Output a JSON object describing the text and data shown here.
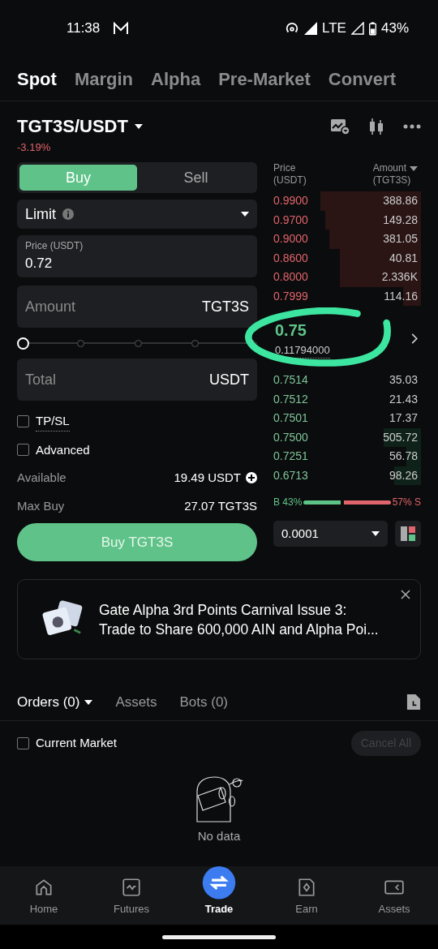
{
  "status_bar": {
    "time": "11:38",
    "network": "LTE",
    "battery": "43%"
  },
  "tabs": [
    {
      "label": "Spot",
      "selected": true
    },
    {
      "label": "Margin",
      "selected": false
    },
    {
      "label": "Alpha",
      "selected": false
    },
    {
      "label": "Pre-Market",
      "selected": false
    },
    {
      "label": "Convert",
      "selected": false
    }
  ],
  "pair": {
    "name": "TGT3S/USDT",
    "change": "-3.19%"
  },
  "order_form": {
    "sides": [
      {
        "label": "Buy",
        "selected": true
      },
      {
        "label": "Sell",
        "selected": false
      }
    ],
    "order_type": "Limit",
    "price": {
      "label": "Price (USDT)",
      "value": "0.72"
    },
    "amount": {
      "placeholder": "Amount",
      "unit": "TGT3S"
    },
    "slider": {
      "level": 0
    },
    "total": {
      "placeholder": "Total",
      "unit": "USDT"
    },
    "options": [
      {
        "label": "TP/SL",
        "checked": false
      },
      {
        "label": "Advanced",
        "checked": false
      }
    ],
    "available": {
      "label": "Available",
      "value": "19.49 USDT"
    },
    "max_buy": {
      "label": "Max Buy",
      "value": "27.07 TGT3S"
    },
    "submit": "Buy TGT3S"
  },
  "order_book": {
    "columns": [
      "Price\n(USDT)",
      "Amount",
      "(TGT3S)"
    ],
    "asks": [
      {
        "price": "0.9900",
        "amount": "388.86"
      },
      {
        "price": "0.9700",
        "amount": "149.28"
      },
      {
        "price": "0.9000",
        "amount": "381.05"
      },
      {
        "price": "0.8600",
        "amount": "40.81"
      },
      {
        "price": "0.8000",
        "amount": "2.336K"
      },
      {
        "price": "0.7999",
        "amount": "114.16"
      }
    ],
    "last_price": "0.75",
    "mark_price": "0.11794000",
    "bids": [
      {
        "price": "0.7514",
        "amount": "35.03"
      },
      {
        "price": "0.7512",
        "amount": "21.43"
      },
      {
        "price": "0.7501",
        "amount": "17.37"
      },
      {
        "price": "0.7500",
        "amount": "505.72"
      },
      {
        "price": "0.7251",
        "amount": "56.78"
      },
      {
        "price": "0.6713",
        "amount": "98.26"
      }
    ],
    "ratio": {
      "buy": "B 43%",
      "sell": "57% S",
      "level": 0.43
    },
    "precision": "0.0001"
  },
  "banner": {
    "text": "Gate Alpha 3rd Points Carnival Issue 3:\nTrade to Share 600,000 AIN and Alpha Poi..."
  },
  "orders": {
    "tabs": [
      {
        "label": "Orders (0)",
        "selected": true
      },
      {
        "label": "Assets",
        "selected": false
      },
      {
        "label": "Bots (0)",
        "selected": false
      }
    ],
    "filter": {
      "label": "Current Market",
      "checked": false
    },
    "cancel_all": "Cancel All",
    "empty": "No data"
  },
  "bottom_nav": [
    {
      "label": "Home",
      "kind": "home",
      "selected": false
    },
    {
      "label": "Futures",
      "kind": "futures",
      "selected": false
    },
    {
      "label": "Trade",
      "kind": "trade",
      "selected": true
    },
    {
      "label": "Earn",
      "kind": "earn",
      "selected": false
    },
    {
      "label": "Assets",
      "kind": "assets",
      "selected": false
    }
  ]
}
